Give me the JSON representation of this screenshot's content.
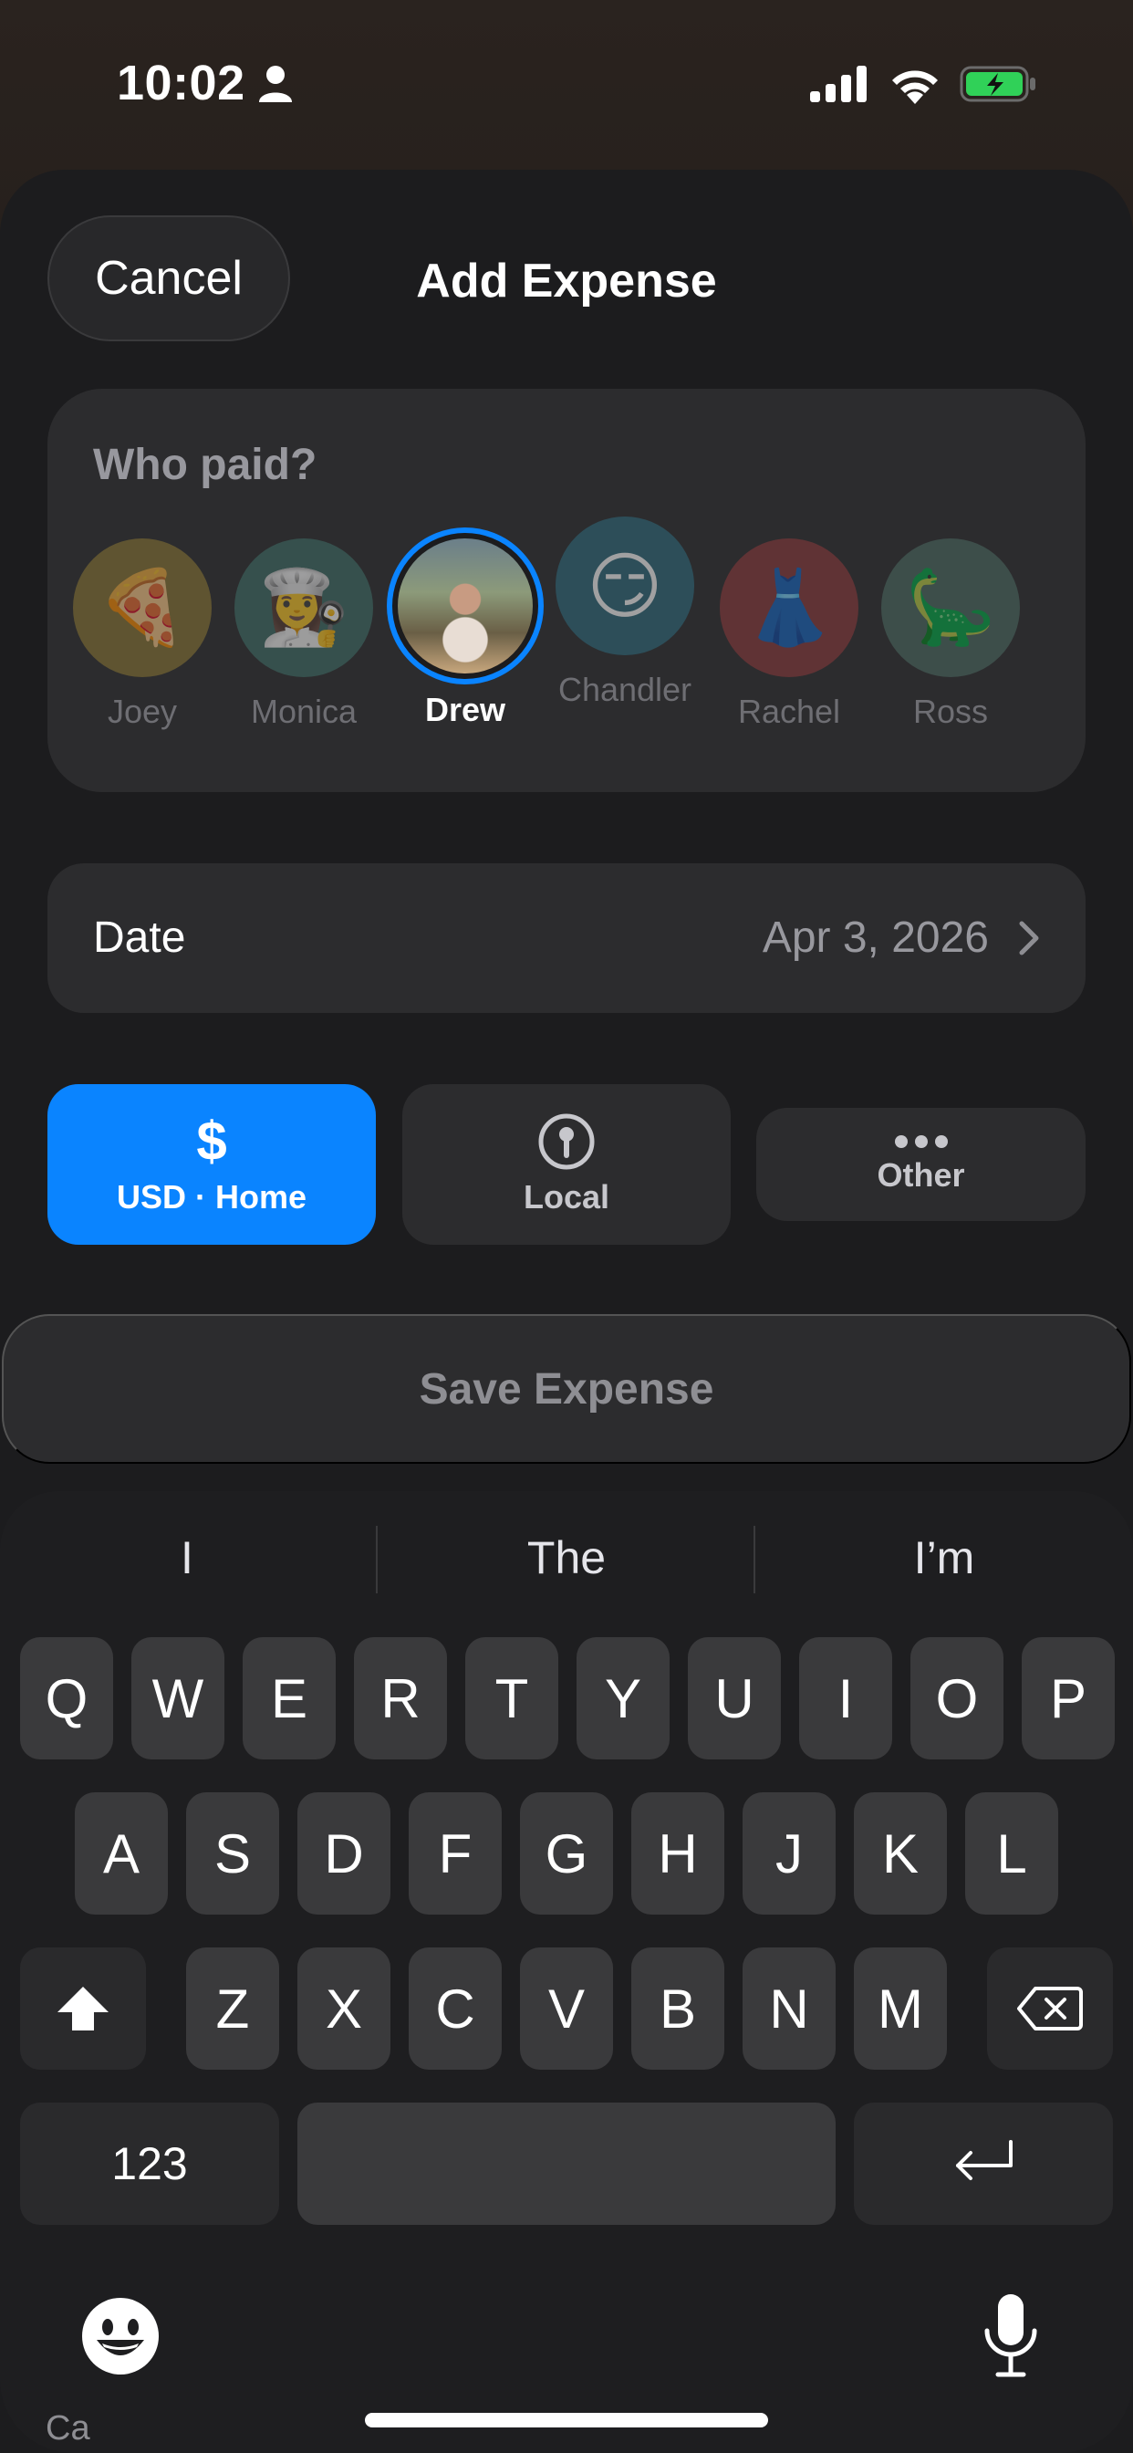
{
  "status_bar": {
    "time": "10:02"
  },
  "header": {
    "cancel_label": "Cancel",
    "title": "Add Expense"
  },
  "payer": {
    "label": "Who paid?",
    "people": [
      {
        "name": "Joey",
        "emoji": "🍕",
        "color": "#8a7634"
      },
      {
        "name": "Monica",
        "emoji": "👩‍🍳",
        "color": "#3f6f67"
      },
      {
        "name": "Drew",
        "selected": true
      },
      {
        "name": "Chandler",
        "emoji": "😏",
        "color": "#2f6b7d"
      },
      {
        "name": "Rachel",
        "emoji": "👗",
        "color": "#8c3a3c"
      },
      {
        "name": "Ross",
        "emoji": "🦕",
        "color": "#4b6a62"
      }
    ]
  },
  "date": {
    "label": "Date",
    "value": "Apr 3, 2026"
  },
  "currency": {
    "home_label": "USD · Home",
    "local_label": "Local",
    "other_label": "Other"
  },
  "save_label": "Save Expense",
  "keyboard": {
    "suggestions": [
      "I",
      "The",
      "I’m"
    ],
    "row1": [
      "Q",
      "W",
      "E",
      "R",
      "T",
      "Y",
      "U",
      "I",
      "O",
      "P"
    ],
    "row2": [
      "A",
      "S",
      "D",
      "F",
      "G",
      "H",
      "J",
      "K",
      "L"
    ],
    "row3": [
      "Z",
      "X",
      "C",
      "V",
      "B",
      "N",
      "M"
    ],
    "numbers_label": "123"
  },
  "behind_text": "Ca",
  "colors": {
    "accent": "#0a84ff",
    "sheet": "#1c1c1e",
    "card": "#2c2c2e"
  }
}
